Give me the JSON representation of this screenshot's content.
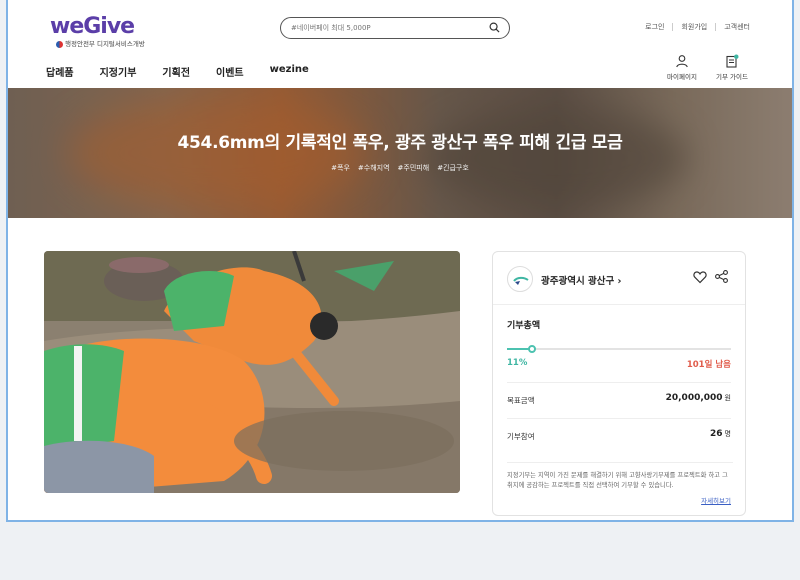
{
  "header": {
    "logo_text": "weGive",
    "logo_sub": "행정안전부 디지털서비스개방",
    "search_placeholder": "#네이버페이 최대 5,000P",
    "top_links": [
      "로그인",
      "회원가입",
      "고객센터"
    ],
    "nav": [
      "답례품",
      "지정기부",
      "기획전",
      "이벤트",
      "wezine"
    ],
    "util": [
      {
        "label": "마이페이지",
        "icon": "user-icon"
      },
      {
        "label": "기부 가이드",
        "icon": "guide-icon"
      }
    ]
  },
  "banner": {
    "title": "454.6mm의 기록적인 폭우, 광주 광산구 폭우 피해 긴급 모금",
    "tags": [
      "#폭우",
      "#수해지역",
      "#주민피해",
      "#긴급구호"
    ]
  },
  "card": {
    "org_name": "광주광역시 광산구 ›",
    "total_label": "기부총액",
    "progress_percent": 11,
    "progress_label": "11%",
    "days_left": "101일 남음",
    "goal_label": "목표금액",
    "goal_value": "20,000,000",
    "goal_unit": "원",
    "participants_label": "기부참여",
    "participants_value": "26",
    "participants_unit": "명",
    "description": "지정기부는 지역이 가진 문제를 해결하기 위해 고향사랑기부제를 프로젝트화 하고 그 취지에 공감하는 프로젝트를 직접 선택하여 기부할 수 있습니다.",
    "more_link": "자세히보기"
  },
  "colors": {
    "brand": "#5b3ea8",
    "accent": "#3fb6a3",
    "alert": "#e05c4b",
    "link": "#3a5fc4"
  }
}
